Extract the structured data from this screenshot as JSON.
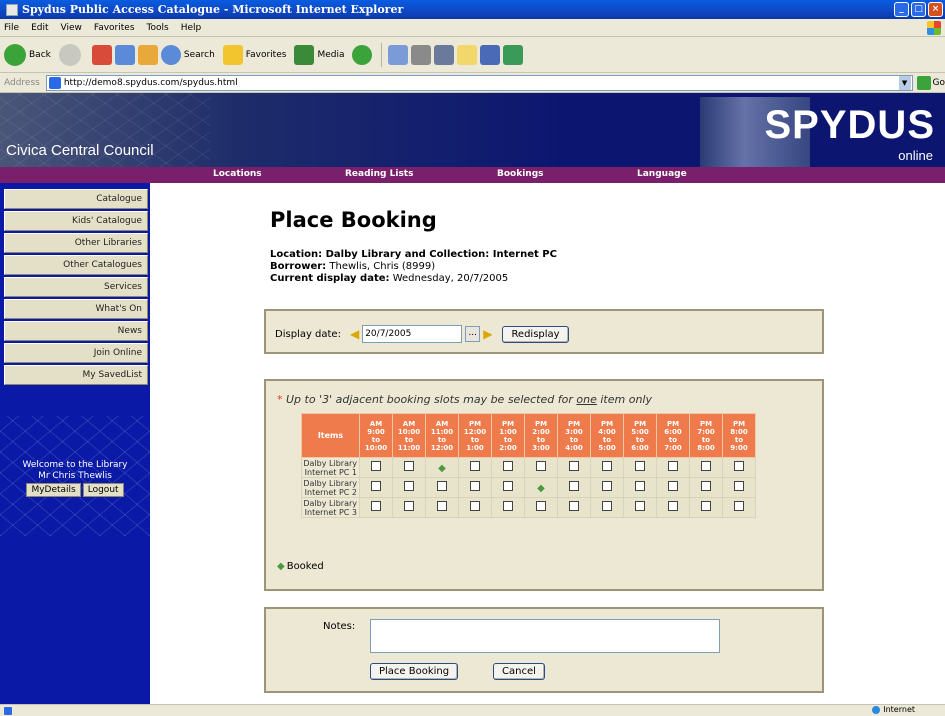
{
  "window": {
    "title": "Spydus Public Access Catalogue - Microsoft Internet Explorer",
    "minimize": "_",
    "maximize": "□",
    "close": "×"
  },
  "menu": [
    "File",
    "Edit",
    "View",
    "Favorites",
    "Tools",
    "Help"
  ],
  "toolbar": {
    "back": "Back",
    "search": "Search",
    "favorites": "Favorites",
    "media": "Media"
  },
  "address": {
    "label": "Address",
    "url": "http://demo8.spydus.com/spydus.html",
    "go": "Go"
  },
  "banner": {
    "council": "Civica Central Council",
    "logo": "SPYDUS",
    "logo_sub": "online"
  },
  "nav": [
    "Locations",
    "Reading Lists",
    "Bookings",
    "Language"
  ],
  "sidebar": {
    "items": [
      "Catalogue",
      "Kids' Catalogue",
      "Other Libraries",
      "Other Catalogues",
      "Services",
      "What's On",
      "News",
      "Join Online",
      "My SavedList"
    ],
    "welcome_line1": "Welcome to the Library",
    "welcome_line2": "Mr Chris Thewlis",
    "my_details": "MyDetails",
    "logout": "Logout"
  },
  "main": {
    "title": "Place Booking",
    "location_line": "Location: Dalby Library and Collection: Internet PC",
    "borrower_label": "Borrower:",
    "borrower_value": "Thewlis, Chris (8999)",
    "date_label": "Current display date:",
    "date_value": "Wednesday, 20/7/2005",
    "display_date_label": "Display date:",
    "display_date_value": "20/7/2005",
    "calendar_button": "...",
    "redisplay": "Redisplay",
    "note_star": "*",
    "note_pre": "Up to '3' adjacent booking slots may be selected for",
    "note_one": "one",
    "note_post": "item only",
    "items_header": "Items",
    "slots": [
      {
        "ampm": "AM",
        "from": "9:00",
        "to": "10:00"
      },
      {
        "ampm": "AM",
        "from": "10:00",
        "to": "11:00"
      },
      {
        "ampm": "AM",
        "from": "11:00",
        "to": "12:00"
      },
      {
        "ampm": "PM",
        "from": "12:00",
        "to": "1:00"
      },
      {
        "ampm": "PM",
        "from": "1:00",
        "to": "2:00"
      },
      {
        "ampm": "PM",
        "from": "2:00",
        "to": "3:00"
      },
      {
        "ampm": "PM",
        "from": "3:00",
        "to": "4:00"
      },
      {
        "ampm": "PM",
        "from": "4:00",
        "to": "5:00"
      },
      {
        "ampm": "PM",
        "from": "5:00",
        "to": "6:00"
      },
      {
        "ampm": "PM",
        "from": "6:00",
        "to": "7:00"
      },
      {
        "ampm": "PM",
        "from": "7:00",
        "to": "8:00"
      },
      {
        "ampm": "PM",
        "from": "8:00",
        "to": "9:00"
      }
    ],
    "to_word": "to",
    "rows": [
      {
        "line1": "Dalby Library",
        "line2": "Internet PC 1",
        "booked": [
          2
        ]
      },
      {
        "line1": "Dalby Library",
        "line2": "Internet PC 2",
        "booked": [
          5
        ]
      },
      {
        "line1": "Dalby Library",
        "line2": "Internet PC 3",
        "booked": []
      }
    ],
    "booked_mark": "◆",
    "legend": "Booked",
    "notes_label": "Notes:",
    "notes_value": "",
    "place_booking": "Place Booking",
    "cancel": "Cancel"
  },
  "status": {
    "zone": "Internet"
  }
}
